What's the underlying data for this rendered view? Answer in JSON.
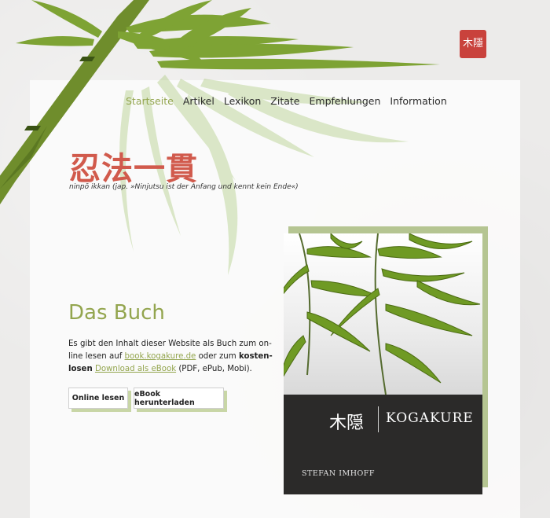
{
  "nav": {
    "items": [
      {
        "label": "Startseite",
        "active": true
      },
      {
        "label": "Artikel"
      },
      {
        "label": "Lexikon"
      },
      {
        "label": "Zitate"
      },
      {
        "label": "Empfehlungen"
      },
      {
        "label": "Information"
      }
    ]
  },
  "header": {
    "title": "忍法一貫",
    "subtitle": "ninpō ikkan (jap. »Ninjutsu ist der Anfang und kennt kein Ende«)",
    "seal_text": "木隱"
  },
  "section": {
    "title": "Das Buch",
    "text_before_link1": "Es gibt den Inhalt dieser Website als Buch zum on-line lesen auf ",
    "link1": "book.kogakure.de",
    "text_between": " oder zum ",
    "bold": "kosten-losen",
    "link2": "Download als eBook",
    "text_after": " (PDF, ePub, Mobi).",
    "buttons": {
      "online": "Online lesen",
      "ebook": "eBook herunterladen"
    }
  },
  "cover": {
    "kanji": "木隠",
    "title": "KOGAKURE",
    "author": "STEFAN IMHOFF"
  },
  "colors": {
    "accent": "#93a54e",
    "brand": "#d15a4c",
    "cover_dark": "#2b2a29",
    "button_shadow": "#c8d6a6"
  },
  "icons": [
    "bamboo-illustration",
    "seal-stamp"
  ]
}
